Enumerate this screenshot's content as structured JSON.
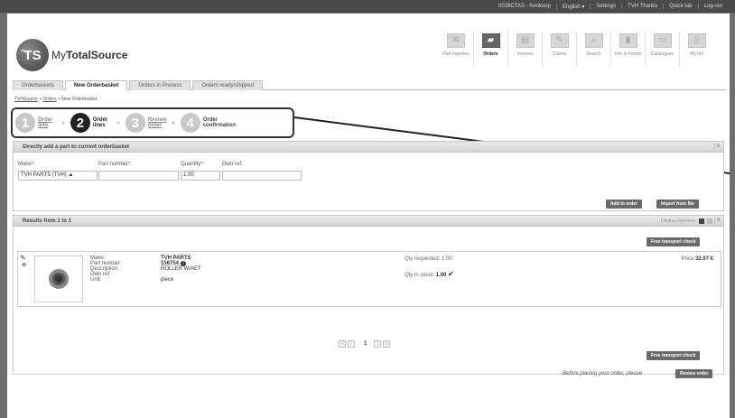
{
  "topbar": {
    "links": [
      "0026CTAS - Kenkoop",
      "English",
      "Settings",
      "TVH Thanks",
      "Quick tab",
      "Log-out"
    ],
    "lang_arrow": "▾"
  },
  "logo": {
    "ts": "TS",
    "my": "My",
    "name_a": "My",
    "name_b": "Total",
    "name_c": "Source"
  },
  "nav": {
    "items": [
      {
        "label": "Part inquiries",
        "icon": "✉"
      },
      {
        "label": "Orders",
        "icon": "▰"
      },
      {
        "label": "Invoices",
        "icon": "▤"
      },
      {
        "label": "Claims",
        "icon": "✎"
      },
      {
        "label": "Search",
        "icon": "⌕"
      },
      {
        "label": "Info & Promo",
        "icon": "▮"
      },
      {
        "label": "Catalogues",
        "icon": "▭"
      },
      {
        "label": "My tvh",
        "icon": "▯"
      }
    ]
  },
  "tabs": [
    "Orderbaskets",
    "New Orderbasket",
    "Orders in Process",
    "Orders ready/shipped"
  ],
  "breadcrumb": {
    "home": "TVHSource",
    "orders": "Orders",
    "current": "New Orderbasket",
    "sep": "»"
  },
  "steps": [
    {
      "num": "1",
      "label": "Order info"
    },
    {
      "num": "2",
      "label": "Order lines"
    },
    {
      "num": "3",
      "label": "Review order"
    },
    {
      "num": "4",
      "label": "Order confirmation"
    }
  ],
  "step_arrow": "»",
  "add_part": {
    "title": "Directly add a part to current orderbasket",
    "collapse": "≡",
    "labels": {
      "make": "Make*:",
      "part_number": "Part number*:",
      "quantity": "Quantity*:",
      "own_ref": "Own ref:"
    },
    "values": {
      "make": "TVH PARTS (TVH)",
      "part_number": "",
      "quantity": "1.00",
      "own_ref": ""
    },
    "make_arrow": "▲",
    "add_button": "Add to order",
    "import_button": "Import from file"
  },
  "results": {
    "title": "Results from 1 to 1",
    "display_label": "Display overview:",
    "transport_top": "Free transport check",
    "transport_bottom": "Free transport check",
    "product": {
      "labels": [
        "Make:",
        "Part number:",
        "Description:",
        "Own ref:",
        "Unit:"
      ],
      "make": "TVH PARTS",
      "part_number": "156754",
      "description": "ROLLER W/AET",
      "own_ref": "",
      "unit": "piece",
      "qty_requested_label": "Qty requested:",
      "qty_requested": "1.00",
      "qty_stock_label": "Qty in stock:",
      "qty_stock": "1.00",
      "check": "✔",
      "price_label": "Price:",
      "price": "32.97 €",
      "info": "i",
      "edit": "✎",
      "delete": "⊗"
    },
    "pager": {
      "first": "«",
      "prev": "‹",
      "page": "1",
      "next": "›",
      "last": "»"
    }
  },
  "footer": {
    "note": "Before placing your order, please",
    "review_button": "Review order"
  }
}
